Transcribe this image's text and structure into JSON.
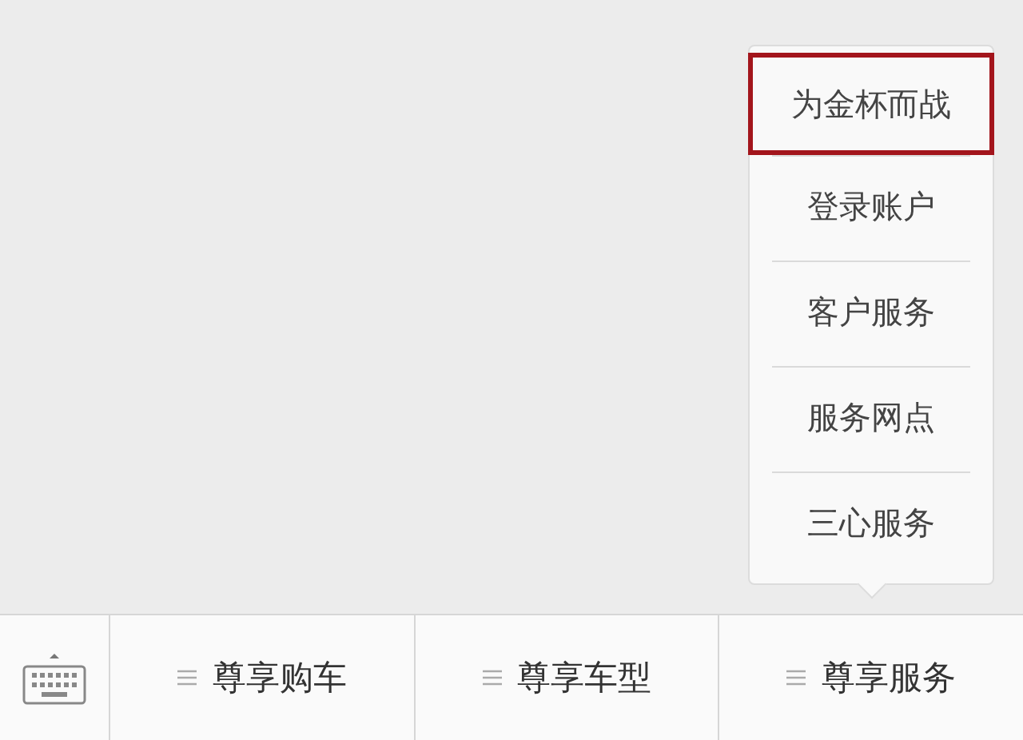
{
  "menu_popup": {
    "items": [
      {
        "label": "为金杯而战",
        "selected": true
      },
      {
        "label": "登录账户",
        "selected": false
      },
      {
        "label": "客户服务",
        "selected": false
      },
      {
        "label": "服务网点",
        "selected": false
      },
      {
        "label": "三心服务",
        "selected": false
      }
    ]
  },
  "bottom_menu": {
    "items": [
      {
        "label": "尊享购车"
      },
      {
        "label": "尊享车型"
      },
      {
        "label": "尊享服务"
      }
    ]
  }
}
